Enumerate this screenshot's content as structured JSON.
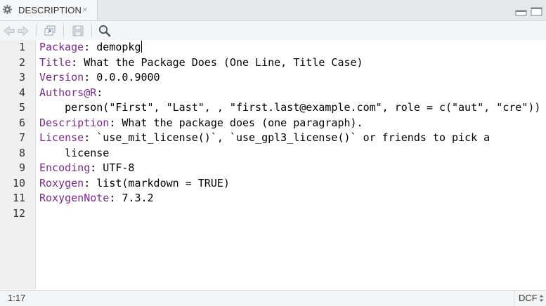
{
  "tab": {
    "label": "DESCRIPTION",
    "close_glyph": "×",
    "icon": "gear-icon"
  },
  "toolbar": {
    "icons": [
      "back-arrow-icon",
      "forward-arrow-icon",
      "show-in-window-icon",
      "save-icon",
      "search-icon"
    ]
  },
  "editor": {
    "line_numbers": [
      "1",
      "2",
      "3",
      "4",
      "5",
      "6",
      "7",
      "8",
      "9",
      "10",
      "11",
      "12"
    ],
    "lines": [
      {
        "key": "Package",
        "rest": ": demopkg"
      },
      {
        "key": "Title",
        "rest": ": What the Package Does (One Line, Title Case)"
      },
      {
        "key": "Version",
        "rest": ": 0.0.0.9000"
      },
      {
        "key": "Authors@R",
        "rest": ":"
      },
      {
        "key": "",
        "rest": "    person(\"First\", \"Last\", , \"first.last@example.com\", role = c(\"aut\", \"cre\"))"
      },
      {
        "key": "Description",
        "rest": ": What the package does (one paragraph)."
      },
      {
        "key": "License",
        "rest": ": `use_mit_license()`, `use_gpl3_license()` or friends to pick a"
      },
      {
        "key": "",
        "rest": "    license"
      },
      {
        "key": "Encoding",
        "rest": ": UTF-8"
      },
      {
        "key": "Roxygen",
        "rest": ": list(markdown = TRUE)"
      },
      {
        "key": "RoxygenNote",
        "rest": ": 7.3.2"
      },
      {
        "key": "",
        "rest": ""
      }
    ]
  },
  "status": {
    "cursor_position": "1:17",
    "mode": "DCF"
  },
  "colors": {
    "field_key": "#7a2c8e",
    "gutter_bg": "#f0f0f0"
  }
}
